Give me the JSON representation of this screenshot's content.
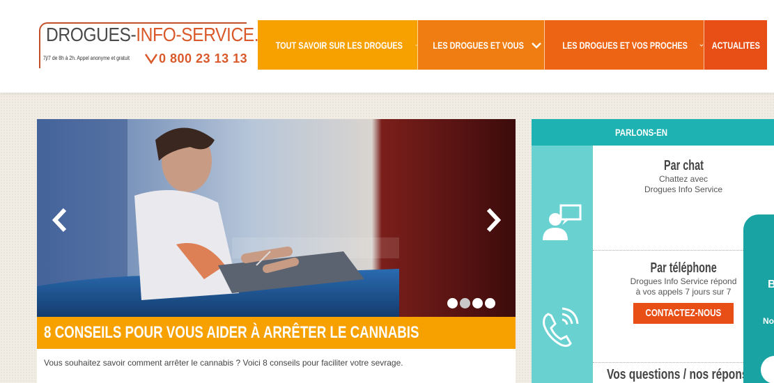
{
  "header": {
    "logo": {
      "name_part1": "DROGUES-",
      "name_part2": "INFO-SERVICE.FR",
      "hours": "7j/7 de 8h à 2h. Appel anonyme et gratuit",
      "phone": "0 800 23 13 13"
    },
    "nav": [
      {
        "label": "TOUT SAVOIR SUR LES DROGUES",
        "has_dropdown": true
      },
      {
        "label": "LES DROGUES ET VOUS",
        "has_dropdown": true
      },
      {
        "label": "LES DROGUES ET VOS PROCHES",
        "has_dropdown": true
      },
      {
        "label": "ACTUALITES",
        "has_dropdown": false
      }
    ]
  },
  "slider": {
    "title": "8 CONSEILS POUR VOUS AIDER À ARRÊTER LE CANNABIS",
    "description": "Vous souhaitez savoir comment arrêter le cannabis ? Voici 8 conseils pour faciliter votre sevrage.",
    "dots": 4,
    "active_dot": 1
  },
  "sidebar": {
    "heading": "PARLONS-EN",
    "chat": {
      "title": "Par chat",
      "line1": "Chattez avec",
      "line2": "Drogues Info Service"
    },
    "phone": {
      "title": "Par téléphone",
      "line1": "Drogues Info Service répond",
      "line2": "à vos appels 7 jours sur 7",
      "button": "CONTACTEZ-NOUS"
    },
    "questions": "Vos questions / nos répons"
  },
  "floating_widget": {
    "letter_b": "B",
    "letters_no": "No"
  },
  "colors": {
    "orange1": "#f7a100",
    "orange2": "#f07d12",
    "orange3": "#ed6514",
    "red_orange": "#e84f16",
    "teal": "#1fb2b2",
    "teal_light": "#6ad1d1"
  }
}
